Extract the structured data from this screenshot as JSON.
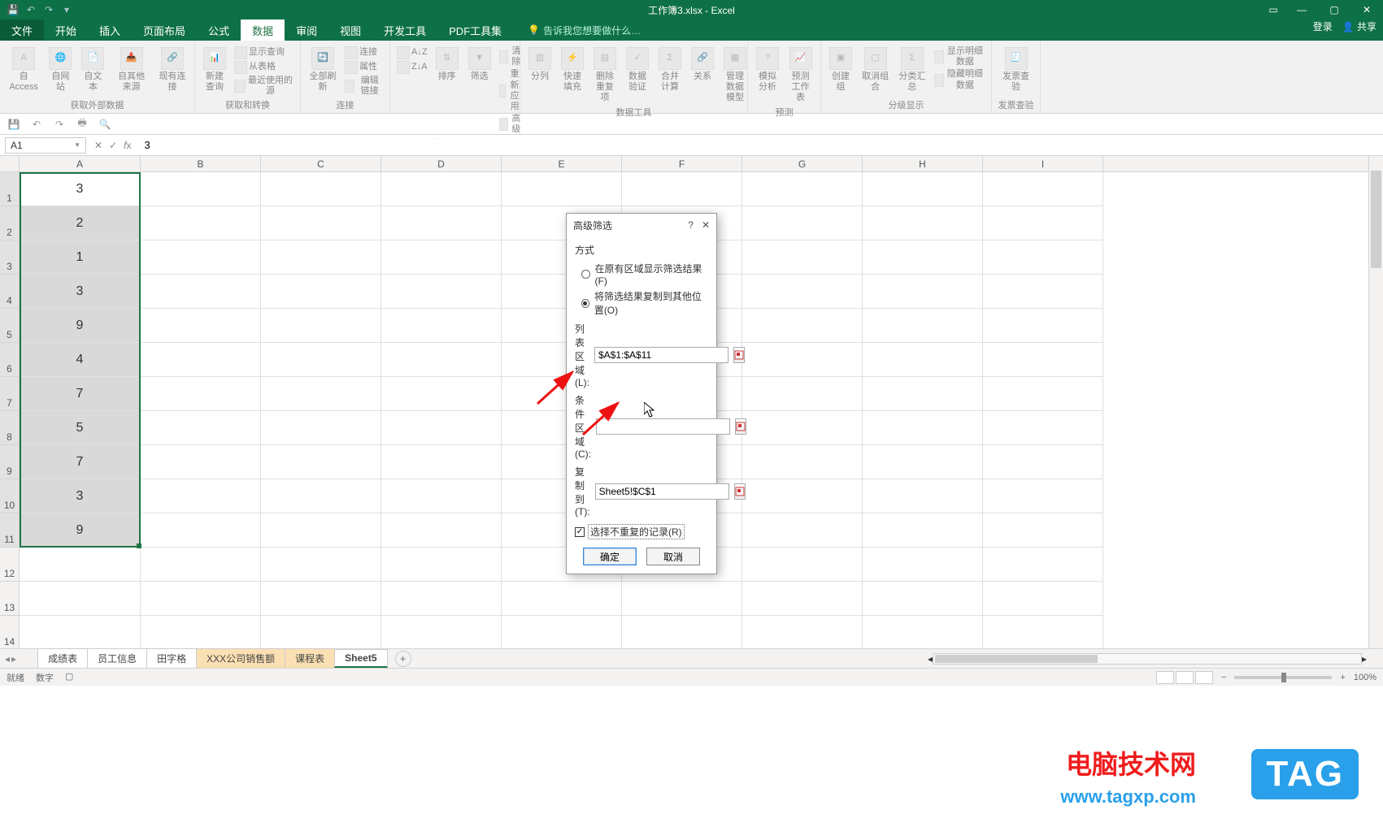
{
  "title": "工作簿3.xlsx - Excel",
  "menu": {
    "file": "文件",
    "tabs": [
      "开始",
      "插入",
      "页面布局",
      "公式",
      "数据",
      "审阅",
      "视图",
      "开发工具",
      "PDF工具集"
    ],
    "active": "数据",
    "tellme": "告诉我您想要做什么…",
    "login": "登录",
    "share": "共享"
  },
  "ribbon": {
    "g1": {
      "label": "获取外部数据",
      "btns": [
        "自 Access",
        "自网站",
        "自文本",
        "自其他来源",
        "现有连接"
      ]
    },
    "g2": {
      "label": "获取和转换",
      "new_query": "新建\n查询",
      "opts": [
        "显示查询",
        "从表格",
        "最近使用的源"
      ]
    },
    "g3": {
      "label": "连接",
      "refresh": "全部刷新",
      "opts": [
        "连接",
        "属性",
        "编辑链接"
      ]
    },
    "g4": {
      "label": "排序和筛选",
      "sort_az": "A↓Z",
      "sort_za": "Z↓A",
      "sort": "排序",
      "filter": "筛选",
      "opts": [
        "清除",
        "重新应用",
        "高级"
      ]
    },
    "g5": {
      "label": "数据工具",
      "btns": [
        "分列",
        "快速填充",
        "删除重复项",
        "数据验证",
        "合并计算",
        "关系",
        "管理数据模型"
      ]
    },
    "g6": {
      "label": "预测",
      "btns": [
        "模拟分析",
        "预测工作表"
      ]
    },
    "g7": {
      "label": "分级显示",
      "btns": [
        "创建组",
        "取消组合",
        "分类汇总"
      ],
      "opts": [
        "显示明细数据",
        "隐藏明细数据"
      ]
    },
    "g8": {
      "label": "发票查验",
      "btn": "发票查验"
    }
  },
  "namebox": "A1",
  "formula": "3",
  "columns": [
    "A",
    "B",
    "C",
    "D",
    "E",
    "F",
    "G",
    "H",
    "I"
  ],
  "rows_count": 14,
  "col_a_values": [
    "3",
    "2",
    "1",
    "3",
    "9",
    "4",
    "7",
    "5",
    "7",
    "3",
    "9"
  ],
  "dialog": {
    "title": "高级筛选",
    "help": "?",
    "close": "✕",
    "group": "方式",
    "opt1": "在原有区域显示筛选结果(F)",
    "opt2": "将筛选结果复制到其他位置(O)",
    "list_label": "列表区域(L):",
    "list_value": "$A$1:$A$11",
    "crit_label": "条件区域(C):",
    "crit_value": "",
    "copy_label": "复制到(T):",
    "copy_value": "Sheet5!$C$1",
    "unique": "选择不重复的记录(R)",
    "ok": "确定",
    "cancel": "取消"
  },
  "sheets": [
    "成绩表",
    "员工信息",
    "田字格",
    "XXX公司销售额",
    "课程表",
    "Sheet5"
  ],
  "active_sheet": "Sheet5",
  "highlight_sheets": [
    "XXX公司销售额",
    "课程表"
  ],
  "status": {
    "ready": "就绪",
    "num": "数字"
  },
  "zoom": "100%",
  "watermark": {
    "brand": "电脑技术网",
    "url": "www.tagxp.com",
    "tag": "TAG"
  }
}
